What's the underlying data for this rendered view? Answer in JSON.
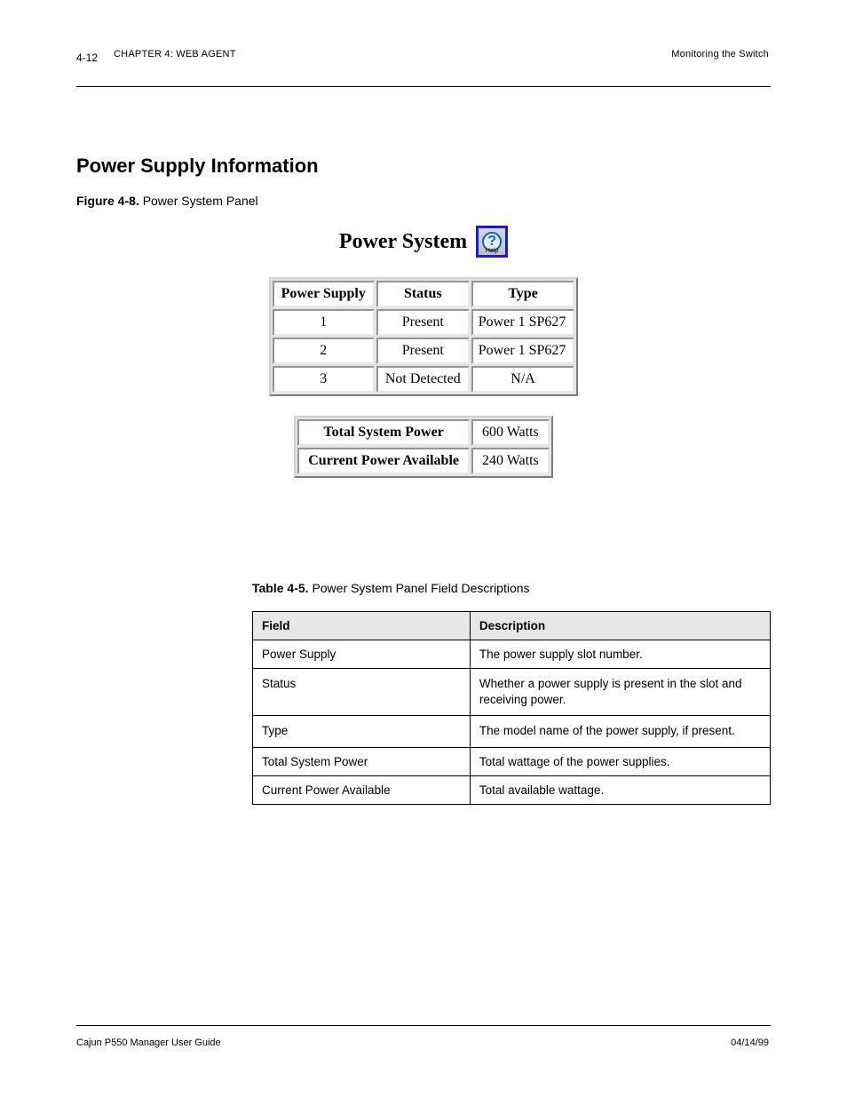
{
  "header": {
    "page_num": "4-12",
    "left": "CHAPTER 4: WEB AGENT",
    "right": "Monitoring the Switch"
  },
  "section_title": "Power Supply Information",
  "figure": {
    "label": "Figure 4-8. ",
    "title": "Power System Panel"
  },
  "panel": {
    "title": "Power System",
    "help_label": "Help",
    "ps_table": {
      "headers": [
        "Power Supply",
        "Status",
        "Type"
      ],
      "rows": [
        {
          "supply": "1",
          "status": "Present",
          "type": "Power 1 SP627"
        },
        {
          "supply": "2",
          "status": "Present",
          "type": "Power 1 SP627"
        },
        {
          "supply": "3",
          "status": "Not Detected",
          "type": "N/A"
        }
      ]
    },
    "summary": {
      "rows": [
        {
          "label": "Total System Power",
          "value": "600 Watts"
        },
        {
          "label": "Current Power Available",
          "value": "240 Watts"
        }
      ]
    }
  },
  "desc_table": {
    "label": "Table 4-5. ",
    "title": "Power System Panel Field Descriptions",
    "headers": [
      "Field",
      "Description"
    ],
    "rows": [
      {
        "field": "Power Supply",
        "desc": "The power supply slot number."
      },
      {
        "field": "Status",
        "desc": "Whether a power supply is present in the slot and receiving power."
      },
      {
        "field": "Type",
        "desc": "The model name of the power supply, if present."
      },
      {
        "field": "Total System Power",
        "desc": "Total wattage of the power supplies."
      },
      {
        "field": "Current Power Available",
        "desc": "Total available wattage."
      }
    ]
  },
  "footer": {
    "left": "Cajun P550 Manager User Guide",
    "right": "04/14/99"
  }
}
